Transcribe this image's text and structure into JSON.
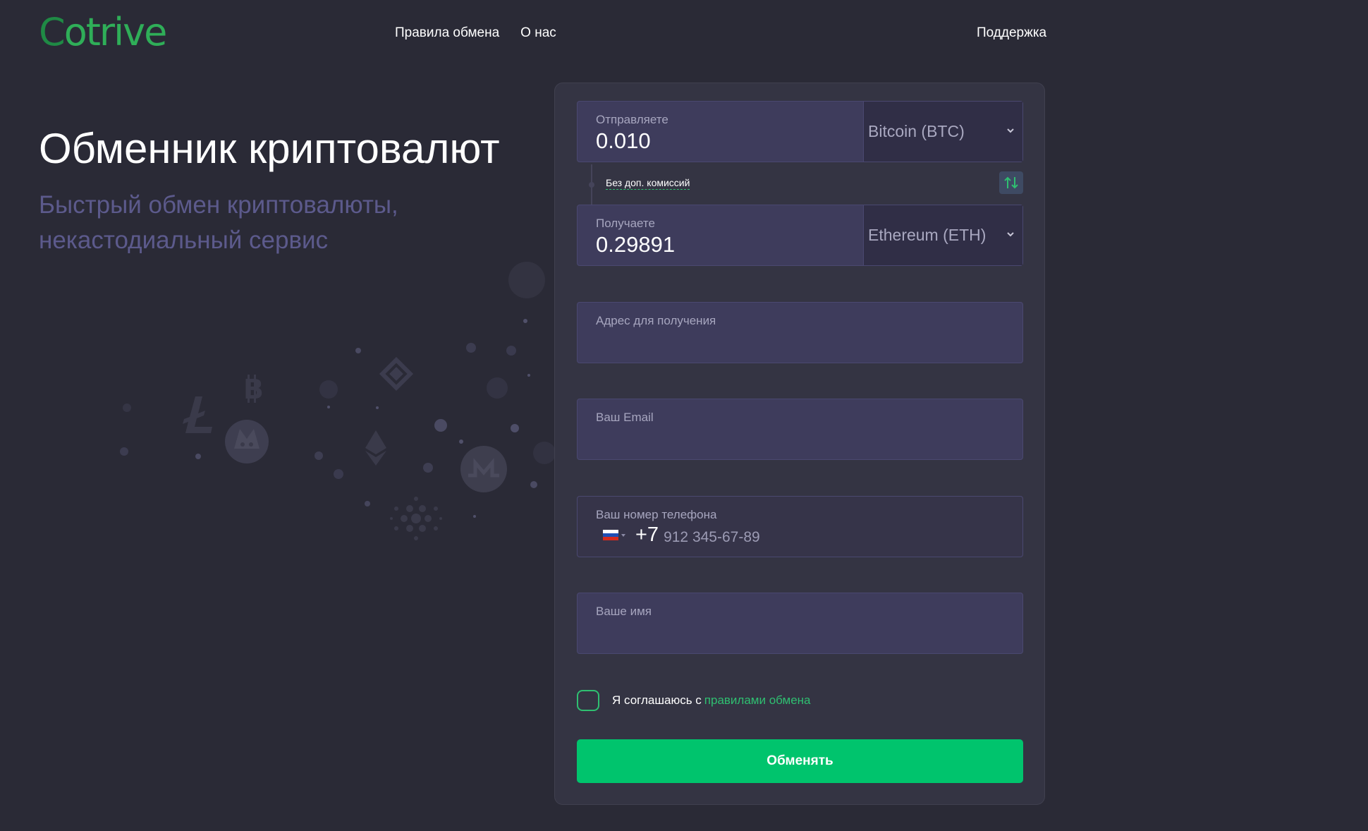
{
  "header": {
    "logo": {
      "first": "C",
      "rest": "otrive"
    },
    "nav": [
      "Правила обмена",
      "О нас"
    ],
    "support": "Поддержка"
  },
  "hero": {
    "title": "Обменник криптовалют",
    "subtitle": "Быстрый обмен криптовалюты, некастодиальный сервис"
  },
  "form": {
    "send": {
      "label": "Отправляете",
      "value": "0.010",
      "currency": "Bitcoin (BTC)"
    },
    "no_fee": "Без доп. комиссий",
    "receive": {
      "label": "Получаете",
      "value": "0.29891",
      "currency": "Ethereum (ETH)"
    },
    "address": {
      "label": "Адрес для получения",
      "value": ""
    },
    "email": {
      "label": "Ваш Email",
      "value": ""
    },
    "phone": {
      "label": "Ваш номер телефона",
      "code": "+7",
      "placeholder": "912 345-67-89"
    },
    "name": {
      "label": "Ваше имя",
      "value": ""
    },
    "agree": {
      "text": "Я соглашаюсь с",
      "link": "правилами обмена",
      "checked": false
    },
    "submit": "Обменять"
  },
  "colors": {
    "background": "#2a2a36",
    "card": "#343443",
    "field": "#3e3c5c",
    "accent": "#00c46d",
    "subtitle": "#5c5a8c"
  },
  "icons": [
    "chevron-down-icon",
    "swap-arrows-icon",
    "russia-flag-icon",
    "litecoin-icon",
    "bitcoin-icon",
    "binance-icon",
    "ethereum-icon",
    "dogecoin-icon",
    "monero-icon",
    "cardano-icon"
  ]
}
